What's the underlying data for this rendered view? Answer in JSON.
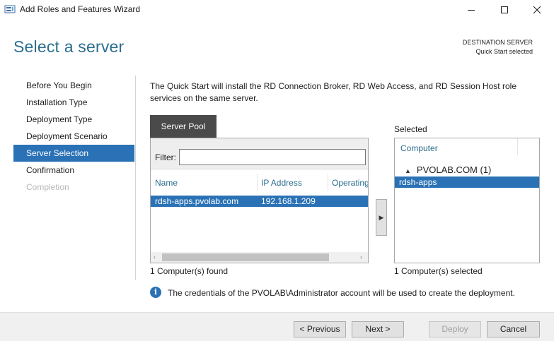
{
  "window": {
    "title": "Add Roles and Features Wizard",
    "icon": "server-manager-icon",
    "controls": [
      "minimize-icon",
      "maximize-icon",
      "close-icon"
    ]
  },
  "header": {
    "title": "Select a server",
    "destination_label": "DESTINATION SERVER",
    "destination_value": "Quick Start selected"
  },
  "nav": {
    "items": [
      {
        "label": "Before You Begin",
        "state": "normal"
      },
      {
        "label": "Installation Type",
        "state": "normal"
      },
      {
        "label": "Deployment Type",
        "state": "normal"
      },
      {
        "label": "Deployment Scenario",
        "state": "normal"
      },
      {
        "label": "Server Selection",
        "state": "active"
      },
      {
        "label": "Confirmation",
        "state": "normal"
      },
      {
        "label": "Completion",
        "state": "disabled"
      }
    ]
  },
  "content": {
    "description": "The Quick Start will install the RD Connection Broker, RD Web Access, and RD Session Host role services on the same server.",
    "server_pool": {
      "tab_label": "Server Pool",
      "filter_label": "Filter:",
      "filter_value": "",
      "columns": [
        "Name",
        "IP Address",
        "Operating"
      ],
      "rows": [
        {
          "name": "rdsh-apps.pvolab.com",
          "ip": "192.168.1.209",
          "os": ""
        }
      ],
      "count_text": "1 Computer(s) found"
    },
    "add_button_glyph": "▶",
    "selected": {
      "label": "Selected",
      "column": "Computer",
      "group": "PVOLAB.COM (1)",
      "items": [
        "rdsh-apps"
      ],
      "count_text": "1 Computer(s) selected"
    },
    "info_message": "The credentials of the PVOLAB\\Administrator account will be used to create the deployment."
  },
  "footer": {
    "previous": "< Previous",
    "next": "Next >",
    "deploy": "Deploy",
    "cancel": "Cancel"
  },
  "colors": {
    "accent": "#2a72b5",
    "title_text": "#2b6e8f",
    "tab_dark": "#4a4a4a",
    "disabled_text": "#b7b7b7"
  }
}
